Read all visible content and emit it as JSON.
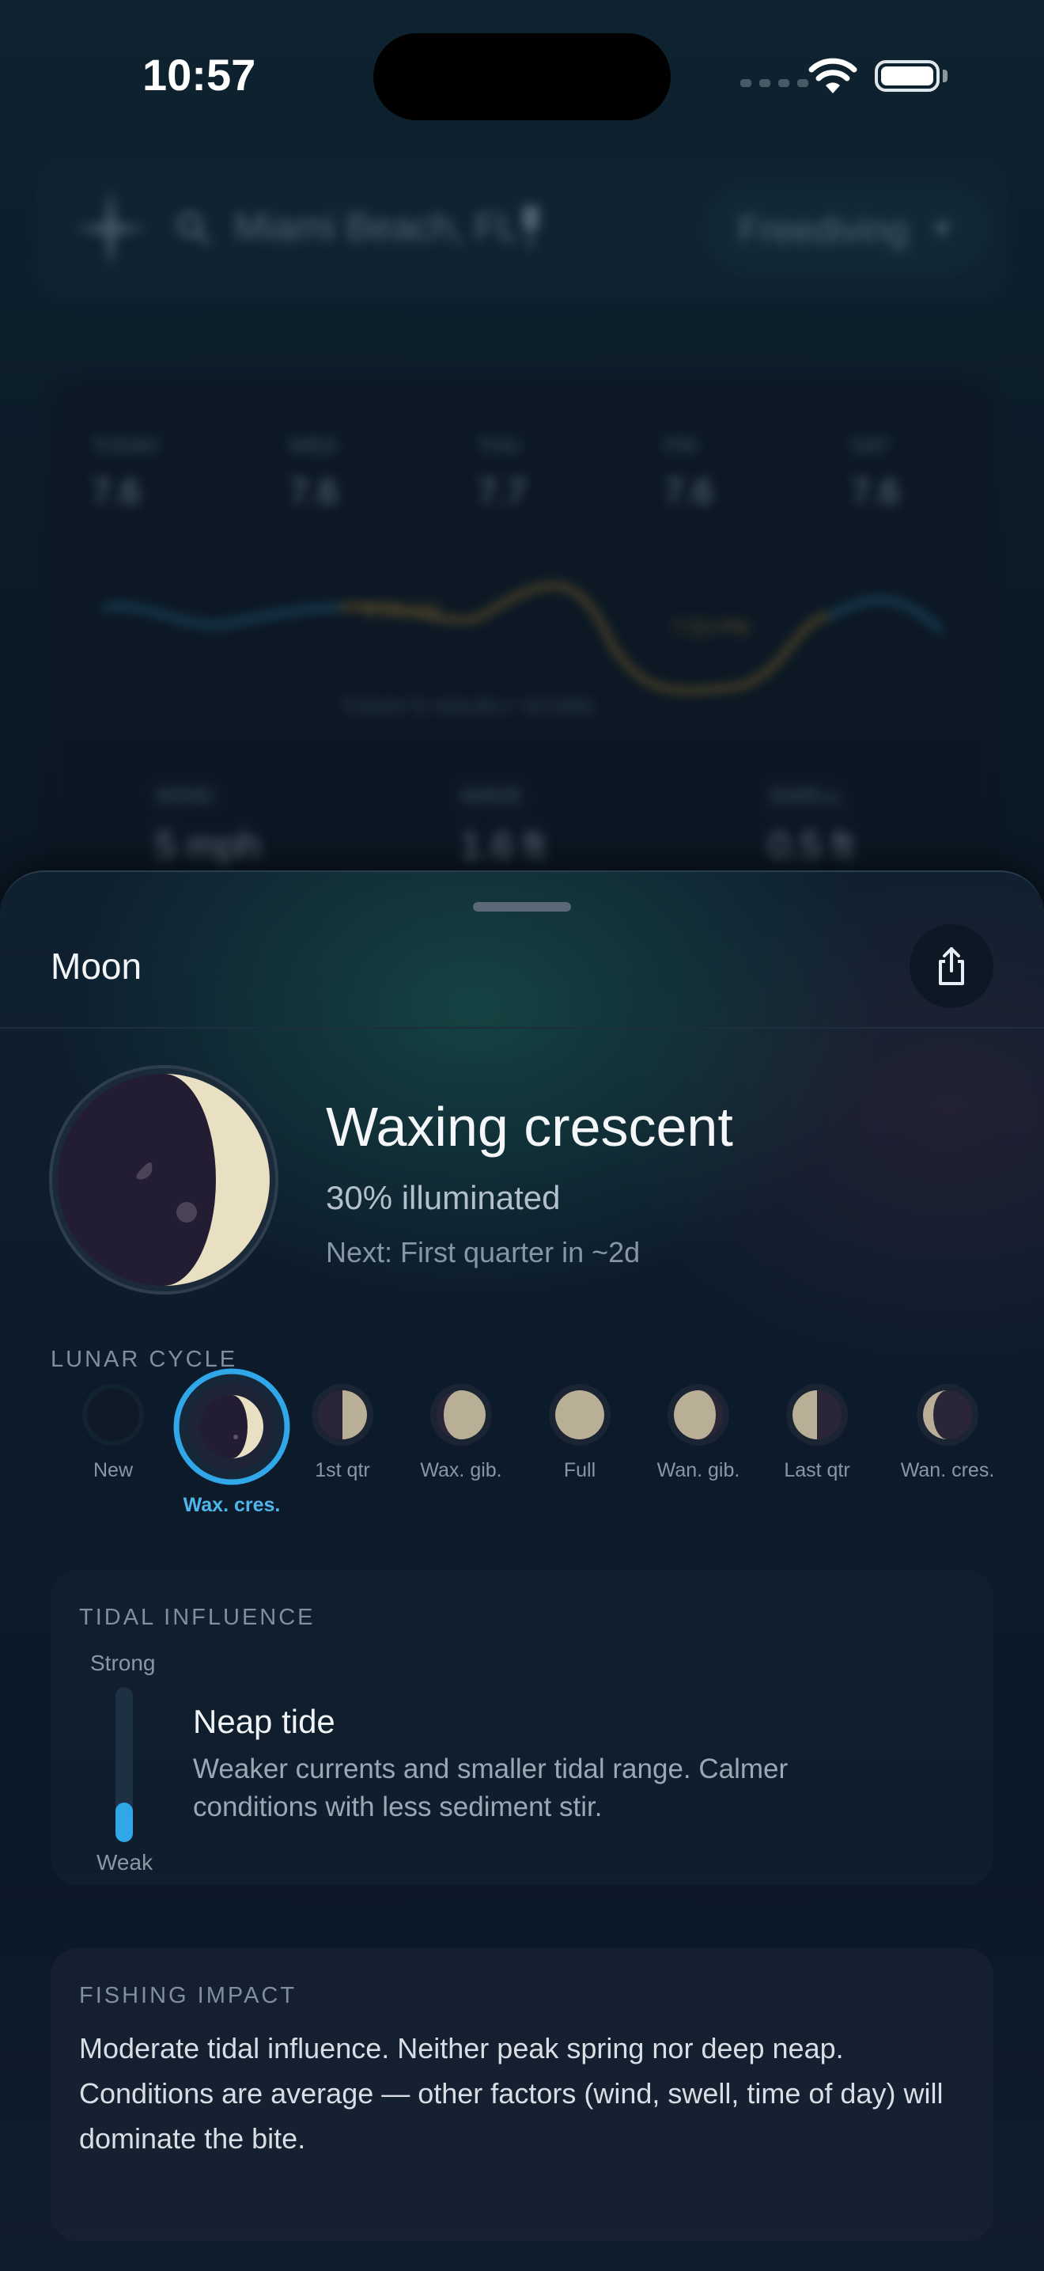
{
  "status_bar": {
    "time": "10:57"
  },
  "background_app": {
    "search": {
      "location": "Miami Beach, FL"
    },
    "activity_selector": {
      "value": "Freediving"
    },
    "forecast": [
      {
        "day": "TODAY",
        "value": "7.6"
      },
      {
        "day": "WED",
        "value": "7.6"
      },
      {
        "day": "THU",
        "value": "7.7"
      },
      {
        "day": "FRI",
        "value": "7.6"
      },
      {
        "day": "SAT",
        "value": "7.6"
      }
    ],
    "chart_caption": "TODAY'S HOURLY SCORE",
    "sunrise_label": "6:59 AM",
    "sunset_label": "7:53 PM",
    "metrics": [
      {
        "label": "WIND",
        "value": "5 mph"
      },
      {
        "label": "WAVE",
        "value": "1.6 ft"
      },
      {
        "label": "SWELL",
        "value": "0.5 ft"
      }
    ]
  },
  "sheet": {
    "title": "Moon",
    "share_icon": "share-icon",
    "phase": {
      "name": "Waxing crescent",
      "illumination_text": "30% illuminated",
      "illumination_fraction": 0.3,
      "next_text": "Next: First quarter in ~2d"
    },
    "lunar_cycle": {
      "label": "LUNAR CYCLE",
      "active_index": 1,
      "phases": [
        {
          "label": "New"
        },
        {
          "label": "Wax. cres."
        },
        {
          "label": "1st qtr"
        },
        {
          "label": "Wax. gib."
        },
        {
          "label": "Full"
        },
        {
          "label": "Wan. gib."
        },
        {
          "label": "Last qtr"
        },
        {
          "label": "Wan. cres."
        }
      ]
    },
    "tidal_influence": {
      "label": "TIDAL INFLUENCE",
      "strong_label": "Strong",
      "weak_label": "Weak",
      "level_fraction": 0.2,
      "title": "Neap tide",
      "description": "Weaker currents and smaller tidal range. Calmer conditions with less sediment stir."
    },
    "fishing_impact": {
      "label": "FISHING IMPACT",
      "text": "Moderate tidal influence. Neither peak spring nor deep neap. Conditions are average — other factors (wind, swell, time of day) will dominate the bite."
    }
  },
  "colors": {
    "accent": "#2fa7e8",
    "moon_light": "#e9dfc2",
    "moon_dark": "#221d33"
  }
}
